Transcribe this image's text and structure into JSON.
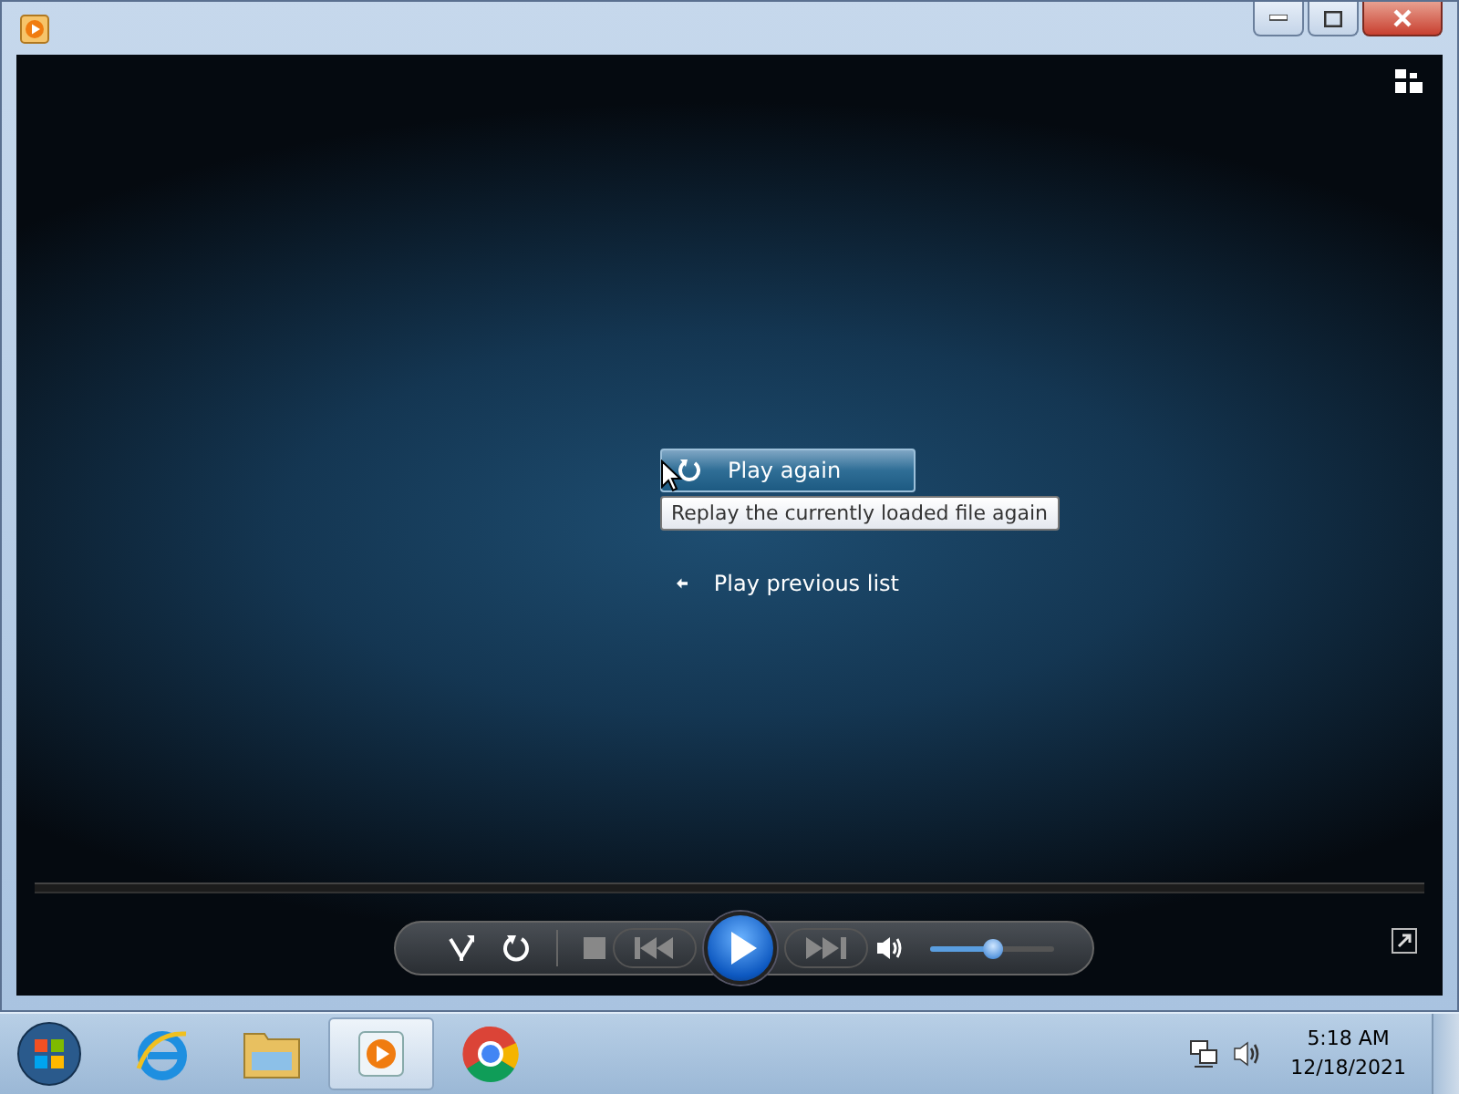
{
  "window": {
    "title_bar_buttons": [
      {
        "kind": "minimize"
      },
      {
        "kind": "maximize"
      },
      {
        "kind": "close"
      }
    ]
  },
  "menu": [
    {
      "kind": "replay",
      "label": "Play again",
      "selected": true
    },
    {
      "kind": "back",
      "label": "Play previous list",
      "selected": false
    }
  ],
  "tooltip": "Replay the currently loaded file again",
  "controls": {
    "volume": {
      "level": 0.5
    }
  },
  "taskbar": {
    "items": [
      {
        "kind": "start",
        "selected": false
      },
      {
        "kind": "browser-e",
        "selected": false
      },
      {
        "kind": "folder",
        "selected": false
      },
      {
        "kind": "player",
        "selected": true
      },
      {
        "kind": "globe",
        "selected": false
      }
    ],
    "time": "5:18 AM",
    "date": "12/18/2021"
  }
}
